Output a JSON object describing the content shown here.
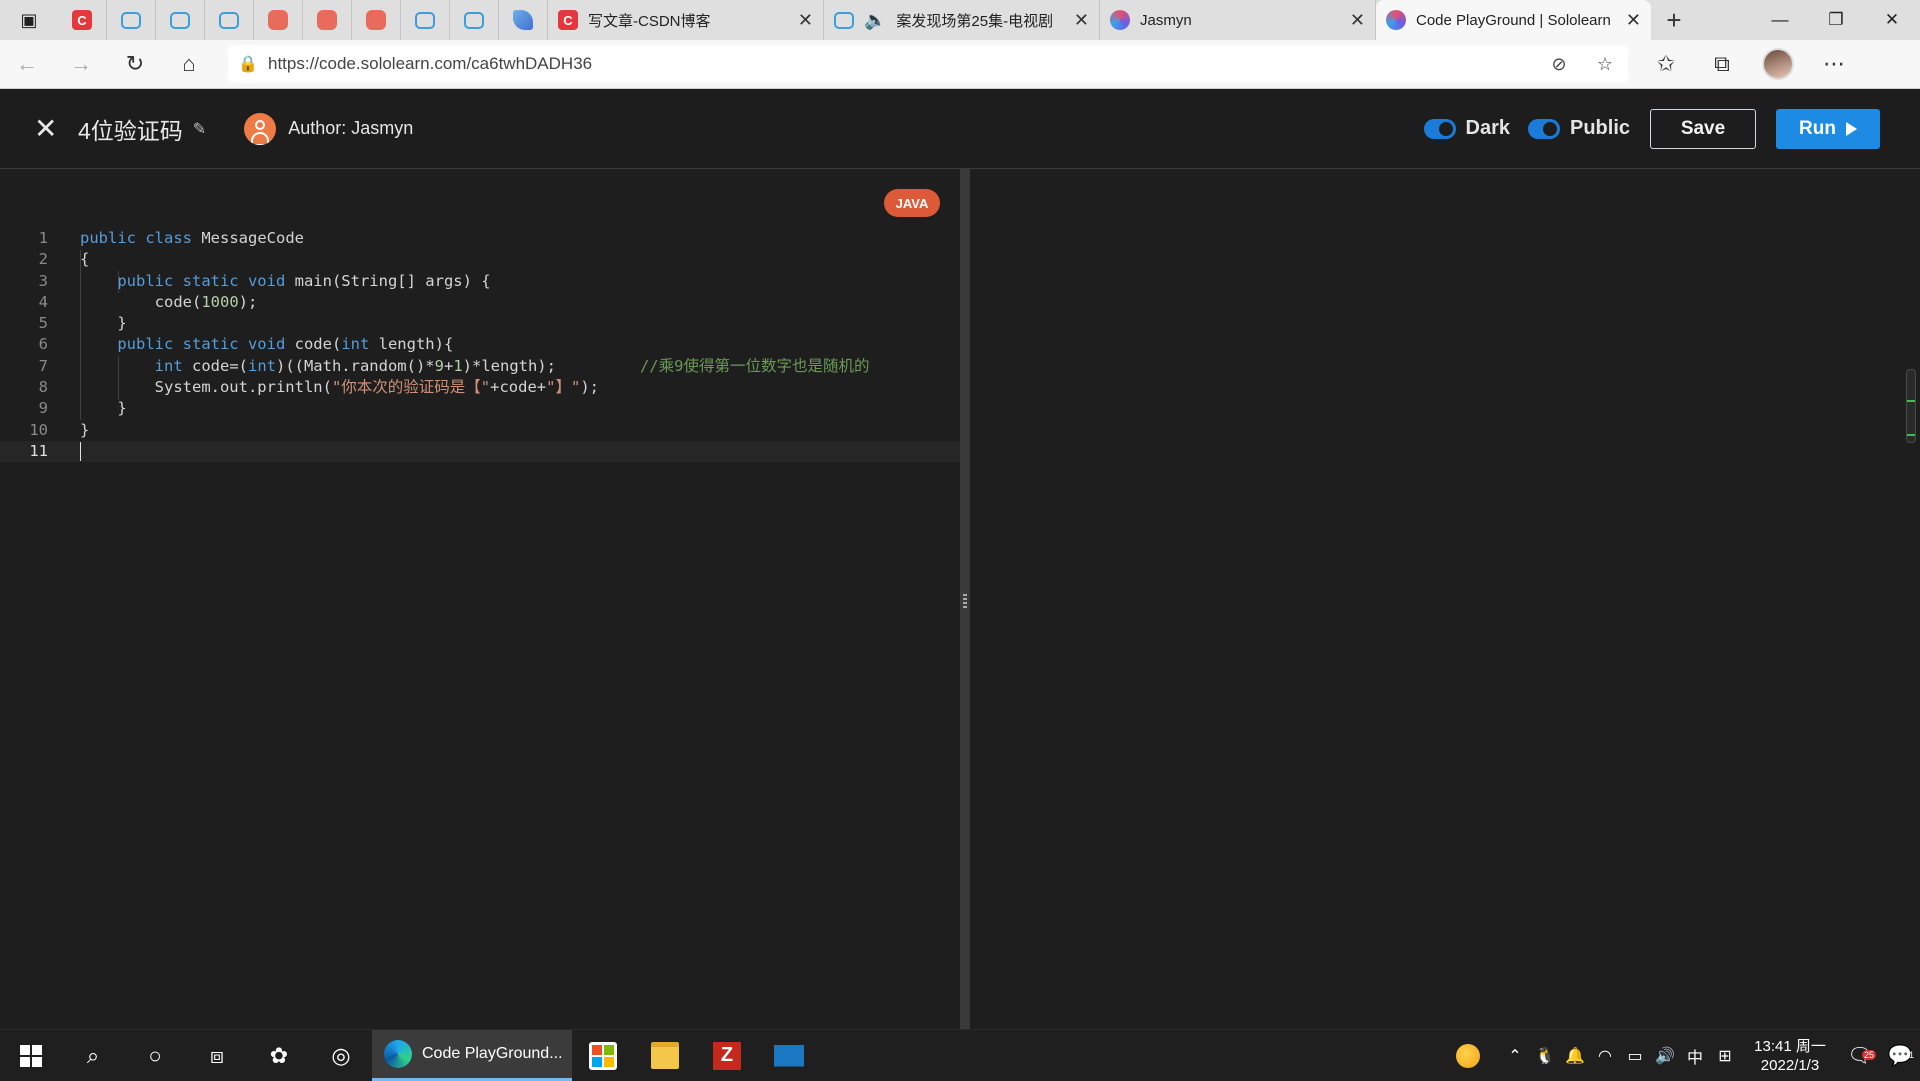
{
  "browser": {
    "tabs": [
      {
        "type": "mini",
        "icon": "csdn"
      },
      {
        "type": "mini",
        "icon": "bilibili"
      },
      {
        "type": "mini",
        "icon": "bilibili"
      },
      {
        "type": "mini",
        "icon": "bilibili"
      },
      {
        "type": "mini",
        "icon": "red"
      },
      {
        "type": "mini",
        "icon": "red"
      },
      {
        "type": "mini",
        "icon": "red"
      },
      {
        "type": "mini",
        "icon": "bilibili"
      },
      {
        "type": "mini",
        "icon": "bilibili"
      },
      {
        "type": "mini",
        "icon": "leaf"
      }
    ],
    "wide_tabs": [
      {
        "title": "写文章-CSDN博客",
        "icon": "csdn"
      },
      {
        "title": "案发现场第25集-电视剧",
        "icon": "bilibili-audio"
      },
      {
        "title": "Jasmyn",
        "icon": "sololearn"
      },
      {
        "title": "Code PlayGround | Sololearn",
        "icon": "sololearn"
      }
    ],
    "url": "https://code.sololearn.com/ca6twhDADH36"
  },
  "app": {
    "code_title": "4位验证码",
    "author": "Author: Jasmyn",
    "toggle_dark": "Dark",
    "toggle_public": "Public",
    "save_label": "Save",
    "run_label": "Run",
    "language": "JAVA"
  },
  "code": {
    "current_line": 11,
    "lines": [
      {
        "n": "1",
        "text": "public class MessageCode"
      },
      {
        "n": "2",
        "text": "{"
      },
      {
        "n": "3",
        "text": "    public static void main(String[] args) {"
      },
      {
        "n": "4",
        "text": "        code(1000);"
      },
      {
        "n": "5",
        "text": "    }"
      },
      {
        "n": "6",
        "text": "    public static void code(int length){"
      },
      {
        "n": "7",
        "text": "        int code=(int)((Math.random()*9+1)*length);",
        "comment": "//乘9使得第一位数字也是随机的"
      },
      {
        "n": "8",
        "text": "        System.out.println(\"你本次的验证码是【\"+code+\"】\");"
      },
      {
        "n": "9",
        "text": "    }"
      },
      {
        "n": "10",
        "text": "}"
      },
      {
        "n": "11",
        "text": ""
      }
    ]
  },
  "taskbar": {
    "active_app": "Code PlayGround...",
    "time": "13:41 周一",
    "date": "2022/1/3",
    "ime": "中",
    "notif_count": "25",
    "action_count": "1"
  }
}
